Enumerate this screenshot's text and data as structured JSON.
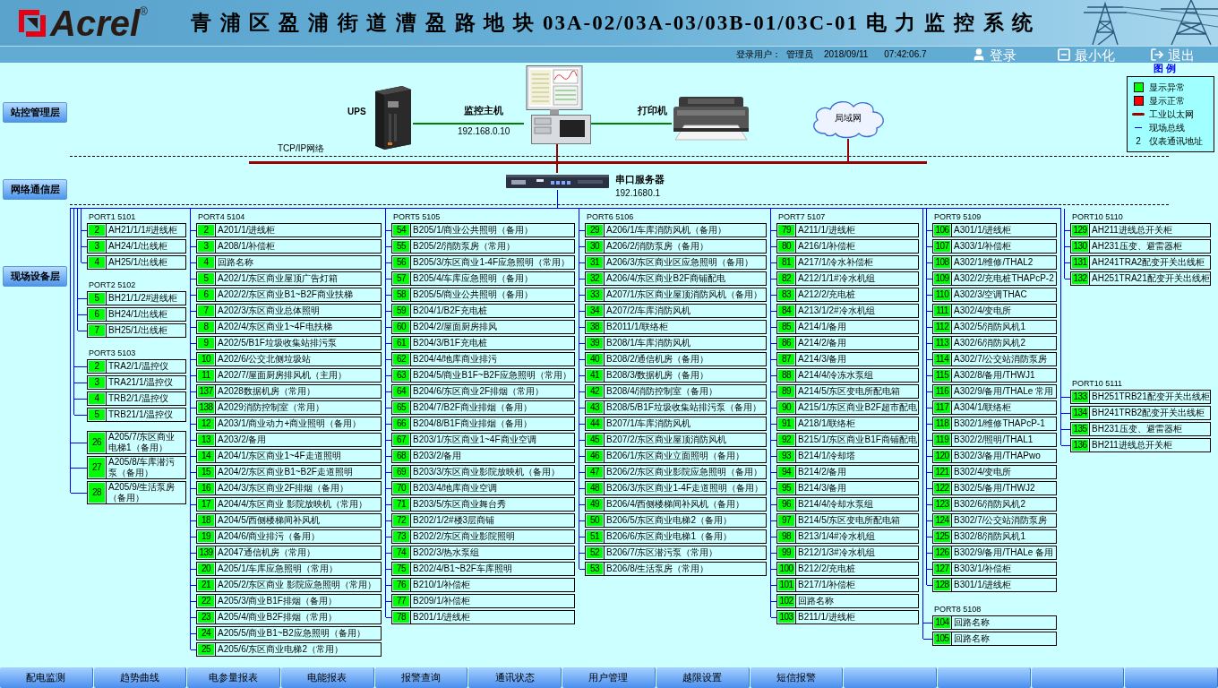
{
  "header": {
    "logo": "Acrel",
    "logo_mark": "®",
    "title": "青 浦 区 盈 浦 街 道 漕 盈 路 地 块 03A-02/03A-03/03B-01/03C-01 电 力 监 控 系 统",
    "user_label": "登录用户：",
    "user": "管理员",
    "date": "2018/09/11",
    "time": "07:42:06.7",
    "buttons": [
      {
        "kind": "login",
        "label": "登录"
      },
      {
        "kind": "minimize",
        "label": "最小化"
      },
      {
        "kind": "exit",
        "label": "退出"
      }
    ]
  },
  "layers": [
    "站控管理层",
    "网络通信层",
    "现场设备层"
  ],
  "network": {
    "ups": "UPS",
    "host": "监控主机",
    "host_ip": "192.168.0.10",
    "printer": "打印机",
    "lan": "局域网",
    "tcpip": "TCP/IP网络",
    "server": "串口服务器",
    "server_ip": "192.1680.1"
  },
  "legend": {
    "title": "图 例",
    "items": [
      {
        "kind": "fill",
        "color": "#00ff00",
        "label": "显示异常"
      },
      {
        "kind": "fill",
        "color": "#ff0000",
        "label": "显示正常"
      },
      {
        "kind": "thick-line",
        "color": "#990000",
        "label": "工业以太网"
      },
      {
        "kind": "thin-line",
        "color": "#0000ff",
        "label": "现场总线"
      },
      {
        "kind": "symbol",
        "symbol": "2",
        "label": "仪表通讯地址"
      }
    ]
  },
  "ports": [
    {
      "title": "PORT1 5101",
      "rows": [
        {
          "address": "2",
          "name": "AH21/1/1#进线柜",
          "abnormal": true
        },
        {
          "address": "3",
          "name": "AH24/1/出线柜",
          "abnormal": true
        },
        {
          "address": "4",
          "name": "AH25/1/出线柜",
          "abnormal": true
        }
      ]
    },
    {
      "title": "PORT2 5102",
      "rows": [
        {
          "address": "5",
          "name": "BH21/1/2#进线柜",
          "abnormal": true
        },
        {
          "address": "6",
          "name": "BH24/1/出线柜",
          "abnormal": true
        },
        {
          "address": "7",
          "name": "BH25/1/出线柜",
          "abnormal": true
        }
      ]
    },
    {
      "title": "PORT3 5103",
      "rows": [
        {
          "address": "2",
          "name": "TRA2/1/温控仪",
          "abnormal": true
        },
        {
          "address": "3",
          "name": "TRA21/1/温控仪",
          "abnormal": true
        },
        {
          "address": "4",
          "name": "TRB2/1/温控仪",
          "abnormal": true
        },
        {
          "address": "5",
          "name": "TRB21/1/温控仪",
          "abnormal": true
        }
      ]
    },
    {
      "title": "PORT4 5104",
      "rows": [
        {
          "address": "2",
          "name": "A201/1/进线柜",
          "abnormal": true
        },
        {
          "address": "3",
          "name": "A208/1/补偿柜",
          "abnormal": true
        },
        {
          "address": "4",
          "name": "回路名称",
          "abnormal": true
        },
        {
          "address": "5",
          "name": "A202/1/东区商业屋顶广告灯箱",
          "abnormal": true
        },
        {
          "address": "6",
          "name": "A202/2/东区商业B1~B2F商业扶梯",
          "abnormal": true
        },
        {
          "address": "7",
          "name": "A202/3/东区商业总体照明",
          "abnormal": true
        },
        {
          "address": "8",
          "name": "A202/4/东区商业1~4F电扶梯",
          "abnormal": true
        },
        {
          "address": "9",
          "name": "A202/5/B1F垃圾收集站排污泵",
          "abnormal": true
        },
        {
          "address": "10",
          "name": "A202/6/公交北侧垃圾站",
          "abnormal": true
        },
        {
          "address": "11",
          "name": "A202/7/屋面厨房排风机（主用）",
          "abnormal": true
        },
        {
          "address": "137",
          "name": "A2028数据机房（常用）",
          "abnormal": true
        },
        {
          "address": "138",
          "name": "A2029消防控制室（常用）",
          "abnormal": true
        },
        {
          "address": "12",
          "name": "A203/1/商业动力+商业照明（备用）",
          "abnormal": true
        },
        {
          "address": "13",
          "name": "A203/2/备用",
          "abnormal": true
        },
        {
          "address": "14",
          "name": "A204/1/东区商业1~4F走道照明",
          "abnormal": true
        },
        {
          "address": "15",
          "name": "A204/2/东区商业B1~B2F走道照明",
          "abnormal": true
        },
        {
          "address": "16",
          "name": "A204/3/东区商业2F排烟（备用）",
          "abnormal": true
        },
        {
          "address": "17",
          "name": "A204/4/东区商业 影院放映机（常用）",
          "abnormal": true
        },
        {
          "address": "18",
          "name": "A204/5/西侧楼梯间补风机",
          "abnormal": true
        },
        {
          "address": "19",
          "name": "A204/6/商业排污（备用）",
          "abnormal": true
        },
        {
          "address": "139",
          "name": "A2047通信机房（常用）",
          "abnormal": true
        },
        {
          "address": "20",
          "name": "A205/1/车库应急照明（常用）",
          "abnormal": true
        },
        {
          "address": "21",
          "name": "A205/2/东区商业 影院应急照明（常用）",
          "abnormal": true
        },
        {
          "address": "22",
          "name": "A205/3/商业B1F排烟（备用）",
          "abnormal": true
        },
        {
          "address": "23",
          "name": "A205/4/商业B2F排烟（常用）",
          "abnormal": true
        },
        {
          "address": "24",
          "name": "A205/5/商业B1~B2应急照明（备用）",
          "abnormal": true
        },
        {
          "address": "25",
          "name": "A205/6/东区商业电梯2（常用）",
          "abnormal": true
        }
      ],
      "continuation": [
        {
          "address": "26",
          "name": "A205/7/东区商业电梯1（备用）",
          "abnormal": true
        },
        {
          "address": "27",
          "name": "A205/8/车库潜污泵（备用）",
          "abnormal": true
        },
        {
          "address": "28",
          "name": "A205/9/生活泵房（备用）",
          "abnormal": true
        }
      ]
    },
    {
      "title": "PORT5 5105",
      "rows": [
        {
          "address": "54",
          "name": "B205/1/商业公共照明（备用）",
          "abnormal": true
        },
        {
          "address": "55",
          "name": "B205/2/消防泵房（常用）",
          "abnormal": true
        },
        {
          "address": "56",
          "name": "B205/3/东区商业1-4F应急照明（常用）",
          "abnormal": true
        },
        {
          "address": "57",
          "name": "B205/4/车库应急照明（备用）",
          "abnormal": true
        },
        {
          "address": "58",
          "name": "B205/5/商业公共照明（备用）",
          "abnormal": true
        },
        {
          "address": "59",
          "name": "B204/1/B2F充电桩",
          "abnormal": true
        },
        {
          "address": "60",
          "name": "B204/2/屋面厨房排风",
          "abnormal": true
        },
        {
          "address": "61",
          "name": "B204/3/B1F充电桩",
          "abnormal": true
        },
        {
          "address": "62",
          "name": "B204/4/地库商业排污",
          "abnormal": true
        },
        {
          "address": "63",
          "name": "B204/5/商业B1F~B2F应急照明（常用）",
          "abnormal": true
        },
        {
          "address": "64",
          "name": "B204/6/东区商业2F排烟（常用）",
          "abnormal": true
        },
        {
          "address": "65",
          "name": "B204/7/B2F商业排烟（备用）",
          "abnormal": true
        },
        {
          "address": "66",
          "name": "B204/8/B1F商业排烟（备用）",
          "abnormal": true
        },
        {
          "address": "67",
          "name": "B203/1/东区商业1~4F商业空调",
          "abnormal": true
        },
        {
          "address": "68",
          "name": "B203/2/备用",
          "abnormal": true
        },
        {
          "address": "69",
          "name": "B203/3/东区商业影院放映机（备用）",
          "abnormal": true
        },
        {
          "address": "70",
          "name": "B203/4/地库商业空调",
          "abnormal": true
        },
        {
          "address": "71",
          "name": "B203/5/东区商业舞台秀",
          "abnormal": true
        },
        {
          "address": "72",
          "name": "B202/1/2#楼3层商铺",
          "abnormal": true
        },
        {
          "address": "73",
          "name": "B202/2/东区商业影院照明",
          "abnormal": true
        },
        {
          "address": "74",
          "name": "B202/3/热水泵组",
          "abnormal": true
        },
        {
          "address": "75",
          "name": "B202/4/B1~B2F车库照明",
          "abnormal": true
        },
        {
          "address": "76",
          "name": "B210/1/补偿柜",
          "abnormal": true
        },
        {
          "address": "77",
          "name": "B209/1/补偿柜",
          "abnormal": true
        },
        {
          "address": "78",
          "name": "B201/1/进线柜",
          "abnormal": true
        }
      ]
    },
    {
      "title": "PORT6 5106",
      "rows": [
        {
          "address": "29",
          "name": "A206/1/车库消防风机（备用）",
          "abnormal": true
        },
        {
          "address": "30",
          "name": "A206/2/消防泵房（备用）",
          "abnormal": true
        },
        {
          "address": "31",
          "name": "A206/3/东区商业区应急照明（备用）",
          "abnormal": true
        },
        {
          "address": "32",
          "name": "A206/4/东区商业B2F商铺配电",
          "abnormal": true
        },
        {
          "address": "33",
          "name": "A207/1/东区商业屋顶消防风机（备用）",
          "abnormal": true
        },
        {
          "address": "34",
          "name": "A207/2/车库消防风机",
          "abnormal": true
        },
        {
          "address": "38",
          "name": "B2011/1/联络柜",
          "abnormal": true
        },
        {
          "address": "39",
          "name": "B208/1/车库消防风机",
          "abnormal": true
        },
        {
          "address": "40",
          "name": "B208/2/通信机房（备用）",
          "abnormal": true
        },
        {
          "address": "41",
          "name": "B208/3/数据机房（备用）",
          "abnormal": true
        },
        {
          "address": "42",
          "name": "B208/4/消防控制室（备用）",
          "abnormal": true
        },
        {
          "address": "43",
          "name": "B208/5/B1F垃圾收集站排污泵（备用）",
          "abnormal": true
        },
        {
          "address": "44",
          "name": "B207/1/车库消防风机",
          "abnormal": true
        },
        {
          "address": "45",
          "name": "B207/2/东区商业屋顶消防风机",
          "abnormal": true
        },
        {
          "address": "46",
          "name": "B206/1/东区商业立面照明（备用）",
          "abnormal": true
        },
        {
          "address": "47",
          "name": "B206/2/东区商业影院应急照明（备用）",
          "abnormal": true
        },
        {
          "address": "48",
          "name": "B206/3/东区商业1-4F走道照明（备用）",
          "abnormal": true
        },
        {
          "address": "49",
          "name": "B206/4/西侧楼梯间补风机（备用）",
          "abnormal": true
        },
        {
          "address": "50",
          "name": "B206/5/东区商业电梯2（备用）",
          "abnormal": true
        },
        {
          "address": "51",
          "name": "B206/6/东区商业电梯1（备用）",
          "abnormal": true
        },
        {
          "address": "52",
          "name": "B206/7/东区潜污泵（常用）",
          "abnormal": true
        },
        {
          "address": "53",
          "name": "B206/8/生活泵房（常用）",
          "abnormal": true
        }
      ]
    },
    {
      "title": "PORT7 5107",
      "rows": [
        {
          "address": "79",
          "name": "A211/1/进线柜",
          "abnormal": true
        },
        {
          "address": "80",
          "name": "A216/1/补偿柜",
          "abnormal": true
        },
        {
          "address": "81",
          "name": "A217/1/冷水补偿柜",
          "abnormal": true
        },
        {
          "address": "82",
          "name": "A212/1/1#冷水机组",
          "abnormal": true
        },
        {
          "address": "83",
          "name": "A212/2/充电桩",
          "abnormal": true
        },
        {
          "address": "84",
          "name": "A213/1/2#冷水机组",
          "abnormal": true
        },
        {
          "address": "85",
          "name": "A214/1/备用",
          "abnormal": true
        },
        {
          "address": "86",
          "name": "A214/2/备用",
          "abnormal": true
        },
        {
          "address": "87",
          "name": "A214/3/备用",
          "abnormal": true
        },
        {
          "address": "88",
          "name": "A214/4/冷冻水泵组",
          "abnormal": true
        },
        {
          "address": "89",
          "name": "A214/5/东区变电所配电箱",
          "abnormal": true
        },
        {
          "address": "90",
          "name": "A215/1/东区商业B2F超市配电",
          "abnormal": true
        },
        {
          "address": "91",
          "name": "A218/1/联络柜",
          "abnormal": true
        },
        {
          "address": "92",
          "name": "B215/1/东区商业B1F商铺配电",
          "abnormal": true
        },
        {
          "address": "93",
          "name": "B214/1/冷却塔",
          "abnormal": true
        },
        {
          "address": "94",
          "name": "B214/2/备用",
          "abnormal": true
        },
        {
          "address": "95",
          "name": "B214/3/备用",
          "abnormal": true
        },
        {
          "address": "96",
          "name": "B214/4/冷却水泵组",
          "abnormal": true
        },
        {
          "address": "97",
          "name": "B214/5/东区变电所配电箱",
          "abnormal": true
        },
        {
          "address": "98",
          "name": "B213/1/4#冷水机组",
          "abnormal": true
        },
        {
          "address": "99",
          "name": "B212/1/3#冷水机组",
          "abnormal": true
        },
        {
          "address": "100",
          "name": "B212/2/充电桩",
          "abnormal": true
        },
        {
          "address": "101",
          "name": "B217/1/补偿柜",
          "abnormal": true
        },
        {
          "address": "102",
          "name": "回路名称",
          "abnormal": true
        },
        {
          "address": "103",
          "name": "B211/1/进线柜",
          "abnormal": true
        }
      ]
    },
    {
      "title": "PORT9 5109",
      "rows": [
        {
          "address": "106",
          "name": "A301/1/进线柜",
          "abnormal": true
        },
        {
          "address": "107",
          "name": "A303/1/补偿柜",
          "abnormal": true
        },
        {
          "address": "108",
          "name": "A302/1/维修/THAL2",
          "abnormal": true
        },
        {
          "address": "109",
          "name": "A302/2/充电桩THAPcP-2",
          "abnormal": true
        },
        {
          "address": "110",
          "name": "A302/3/空调THAC",
          "abnormal": true
        },
        {
          "address": "111",
          "name": "A302/4/变电所",
          "abnormal": true
        },
        {
          "address": "112",
          "name": "A302/5/消防风机1",
          "abnormal": true
        },
        {
          "address": "113",
          "name": "A302/6/消防风机2",
          "abnormal": true
        },
        {
          "address": "114",
          "name": "A302/7/公交站消防泵房",
          "abnormal": true
        },
        {
          "address": "115",
          "name": "A302/8/备用/THWJ1",
          "abnormal": true
        },
        {
          "address": "116",
          "name": "A302/9/备用/THALe 常用",
          "abnormal": true
        },
        {
          "address": "117",
          "name": "A304/1/联络柜",
          "abnormal": true
        },
        {
          "address": "118",
          "name": "B302/1/维修THAPcP-1",
          "abnormal": true
        },
        {
          "address": "119",
          "name": "B302/2/照明/THAL1",
          "abnormal": true
        },
        {
          "address": "120",
          "name": "B302/3/备用/THAPwo",
          "abnormal": true
        },
        {
          "address": "121",
          "name": "B302/4/变电所",
          "abnormal": true
        },
        {
          "address": "122",
          "name": "B302/5/备用/THWJ2",
          "abnormal": true
        },
        {
          "address": "123",
          "name": "B302/6/消防风机2",
          "abnormal": true
        },
        {
          "address": "124",
          "name": "B302/7/公交站消防泵房",
          "abnormal": true
        },
        {
          "address": "125",
          "name": "B302/8/消防风机1",
          "abnormal": true
        },
        {
          "address": "126",
          "name": "B302/9/备用/THALe 备用",
          "abnormal": true
        },
        {
          "address": "127",
          "name": "B303/1/补偿柜",
          "abnormal": true
        },
        {
          "address": "128",
          "name": "B301/1/进线柜",
          "abnormal": true
        }
      ]
    },
    {
      "title": "PORT8 5108",
      "rows": [
        {
          "address": "104",
          "name": "回路名称",
          "abnormal": true
        },
        {
          "address": "105",
          "name": "回路名称",
          "abnormal": true
        }
      ]
    },
    {
      "title": "PORT10 5110",
      "rows": [
        {
          "address": "129",
          "name": "AH211进线总开关柜",
          "abnormal": true
        },
        {
          "address": "130",
          "name": "AH231压变、避雷器柜",
          "abnormal": true
        },
        {
          "address": "131",
          "name": "AH241TRA2配变开关出线柜",
          "abnormal": true
        },
        {
          "address": "132",
          "name": "AH251TRA21配变开关出线柜",
          "abnormal": true
        }
      ]
    },
    {
      "title": "PORT10 5111",
      "rows": [
        {
          "address": "133",
          "name": "BH251TRB21配变开关出线柜",
          "abnormal": true
        },
        {
          "address": "134",
          "name": "BH241TRB2配变开关出线柜",
          "abnormal": true
        },
        {
          "address": "135",
          "name": "BH231压变、避雷器柜",
          "abnormal": true
        },
        {
          "address": "136",
          "name": "BH211进线总开关柜",
          "abnormal": true
        }
      ]
    }
  ],
  "nav": [
    {
      "kind": "label",
      "label": "配电监测"
    },
    {
      "kind": "label",
      "label": "趋势曲线"
    },
    {
      "kind": "label",
      "label": "电参量报表"
    },
    {
      "kind": "label",
      "label": "电能报表"
    },
    {
      "kind": "label",
      "label": "报警查询"
    },
    {
      "kind": "label",
      "label": "通讯状态"
    },
    {
      "kind": "label",
      "label": "用户管理"
    },
    {
      "kind": "label",
      "label": "越限设置"
    },
    {
      "kind": "label",
      "label": "短信报警"
    },
    {
      "kind": "blank"
    },
    {
      "kind": "blank"
    },
    {
      "kind": "blank"
    },
    {
      "kind": "blank"
    }
  ]
}
